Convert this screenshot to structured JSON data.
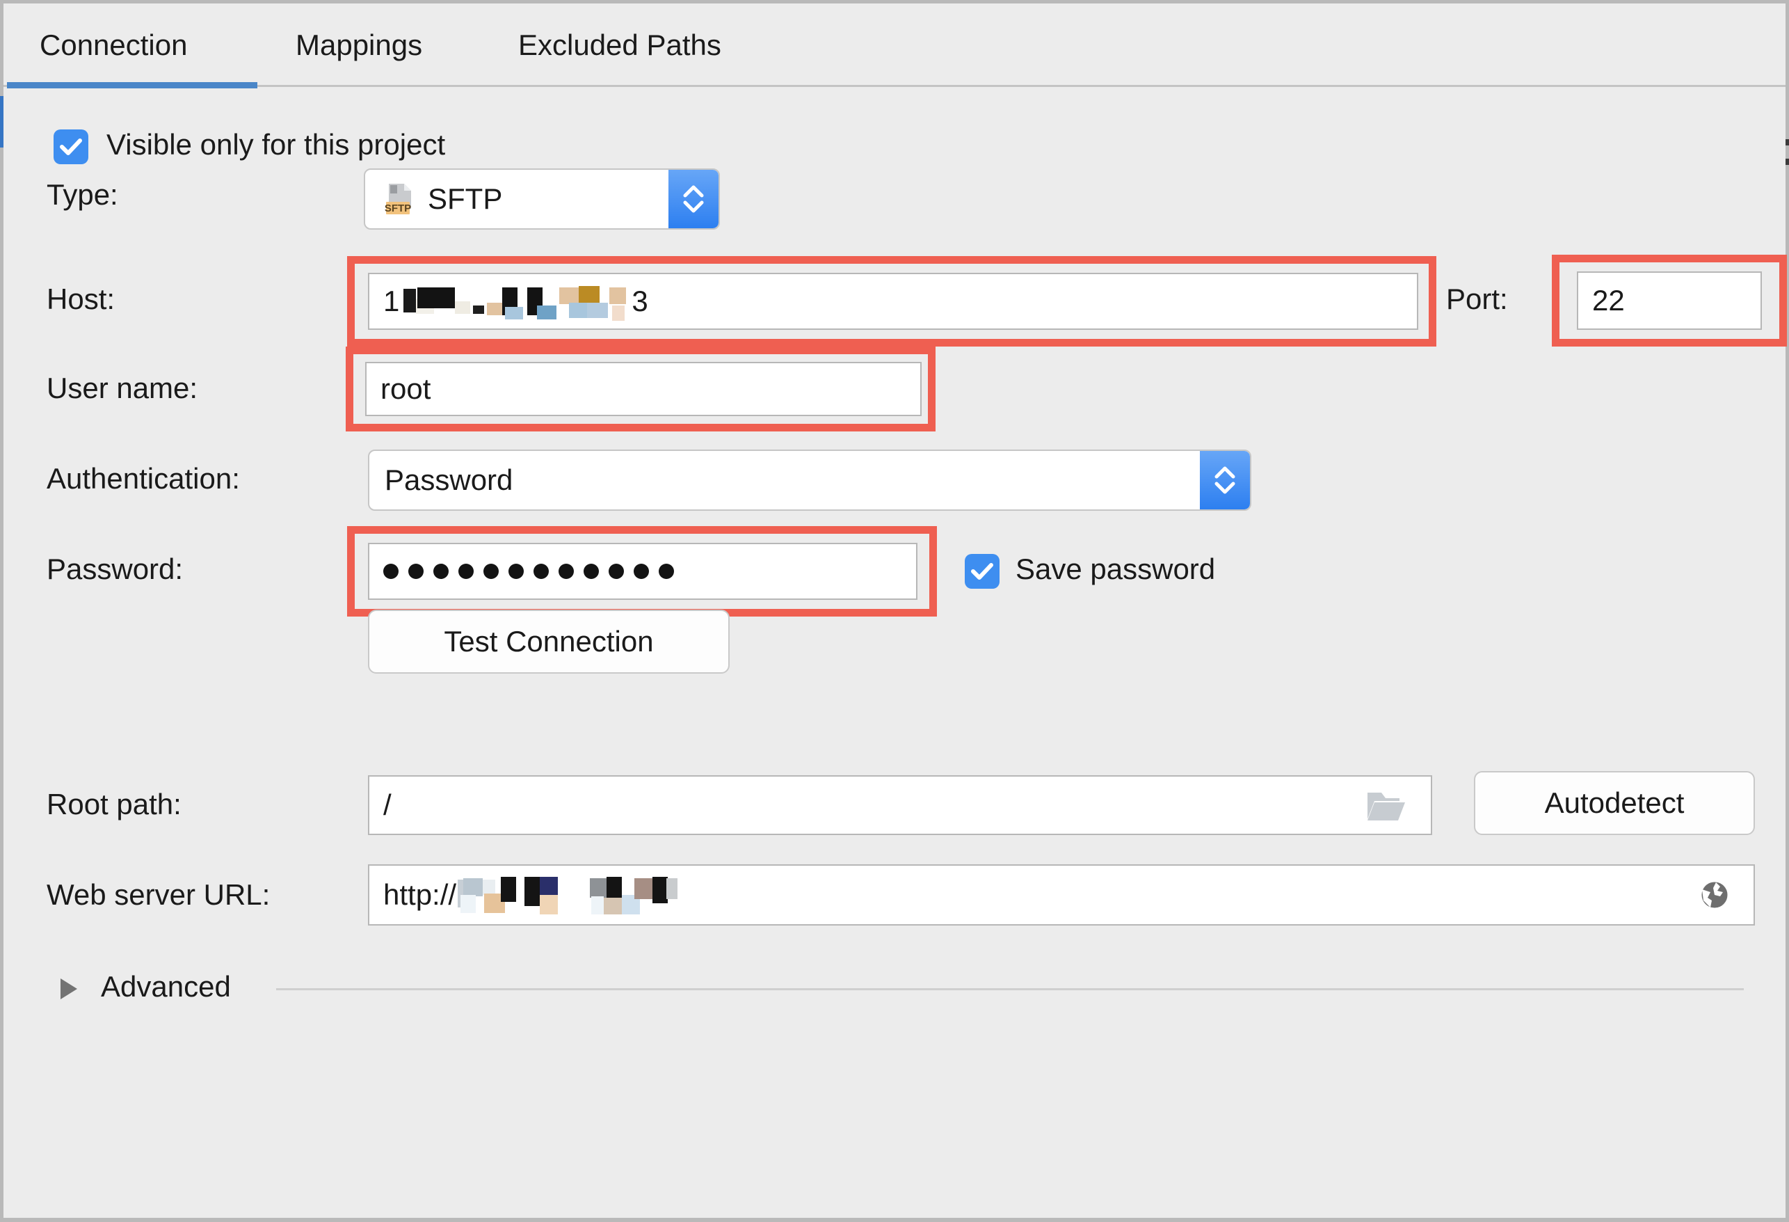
{
  "window": {
    "background_color": "#ececec",
    "accent_color": "#3e8ef0",
    "annotation_color": "#ef5f51"
  },
  "tabs": [
    {
      "label": "Connection",
      "active": true
    },
    {
      "label": "Mappings",
      "active": false
    },
    {
      "label": "Excluded Paths",
      "active": false
    }
  ],
  "form": {
    "visible_only_checkbox": {
      "label": "Visible only for this project",
      "checked": true
    },
    "type": {
      "label": "Type:",
      "value": "SFTP",
      "icon_badge_text": "SFTP",
      "icon_badge_color": "#f2c27c"
    },
    "host": {
      "label": "Host:",
      "value_prefix": "1",
      "value_suffix": "3",
      "redacted": true,
      "annotated": true
    },
    "port": {
      "label": "Port:",
      "value": "22",
      "annotated": true
    },
    "user_name": {
      "label": "User name:",
      "value": "root",
      "annotated": true
    },
    "authentication": {
      "label": "Authentication:",
      "value": "Password"
    },
    "password": {
      "label": "Password:",
      "masked_length": 12,
      "annotated": true
    },
    "save_password_checkbox": {
      "label": "Save password",
      "checked": true
    },
    "test_connection_button": {
      "label": "Test Connection"
    },
    "root_path": {
      "label": "Root path:",
      "value": "/",
      "browse_icon": "folder-icon"
    },
    "autodetect_button": {
      "label": "Autodetect"
    },
    "web_server_url": {
      "label": "Web server URL:",
      "value_prefix": "http://",
      "redacted": true,
      "open_icon": "globe-icon"
    },
    "advanced": {
      "label": "Advanced",
      "expanded": false
    }
  }
}
